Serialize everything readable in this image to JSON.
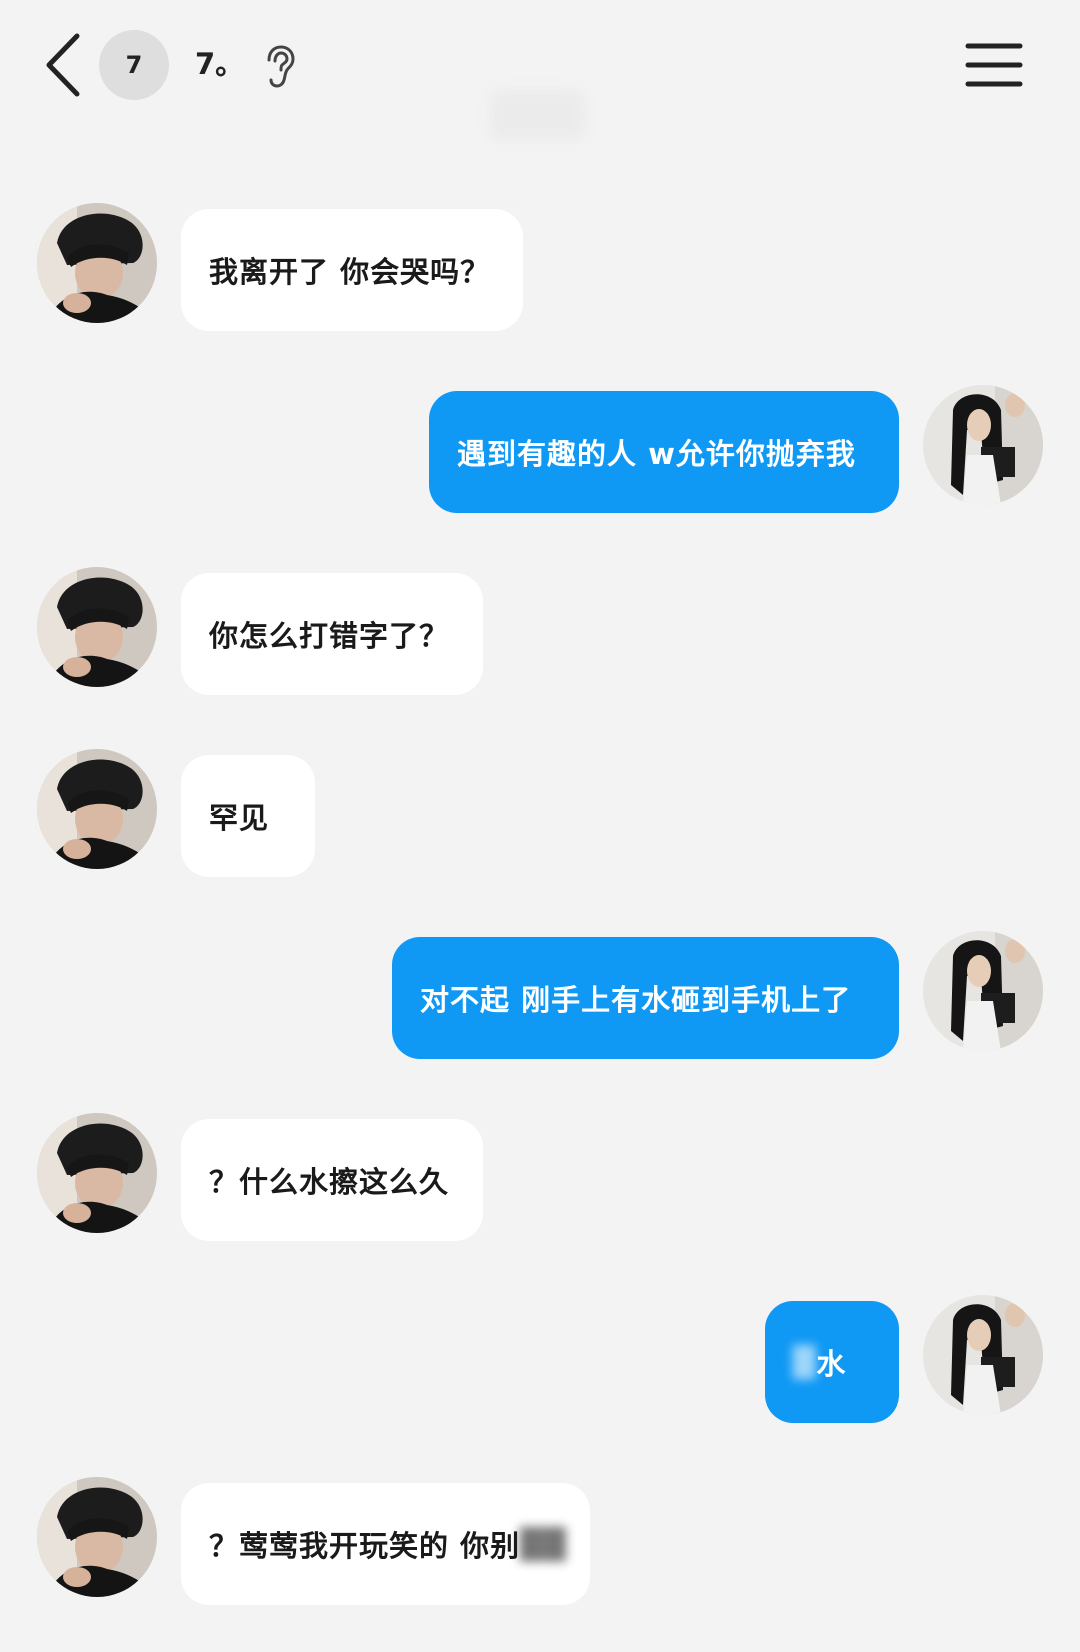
{
  "header": {
    "badge": "7",
    "title": "7。"
  },
  "messages": [
    {
      "side": "in",
      "text": "我离开了 你会哭吗？"
    },
    {
      "side": "out",
      "text": "遇到有趣的人 w允许你抛弃我"
    },
    {
      "side": "in",
      "text": "你怎么打错字了？"
    },
    {
      "side": "in",
      "text": "罕见"
    },
    {
      "side": "out",
      "text": "对不起 刚手上有水砸到手机上了"
    },
    {
      "side": "in",
      "text": "？什么水擦这么久"
    },
    {
      "side": "out",
      "text": "水",
      "blurred_prefix": "█"
    },
    {
      "side": "in",
      "text": "？莺莺我开玩笑的 你别",
      "blurred_suffix": "██"
    }
  ],
  "colors": {
    "background": "#f3f3f3",
    "outgoing_bubble": "#0f98f4",
    "incoming_bubble": "#ffffff"
  },
  "icons": {
    "back": "chevron-left-icon",
    "hearing": "ear-icon",
    "menu": "menu-icon"
  }
}
